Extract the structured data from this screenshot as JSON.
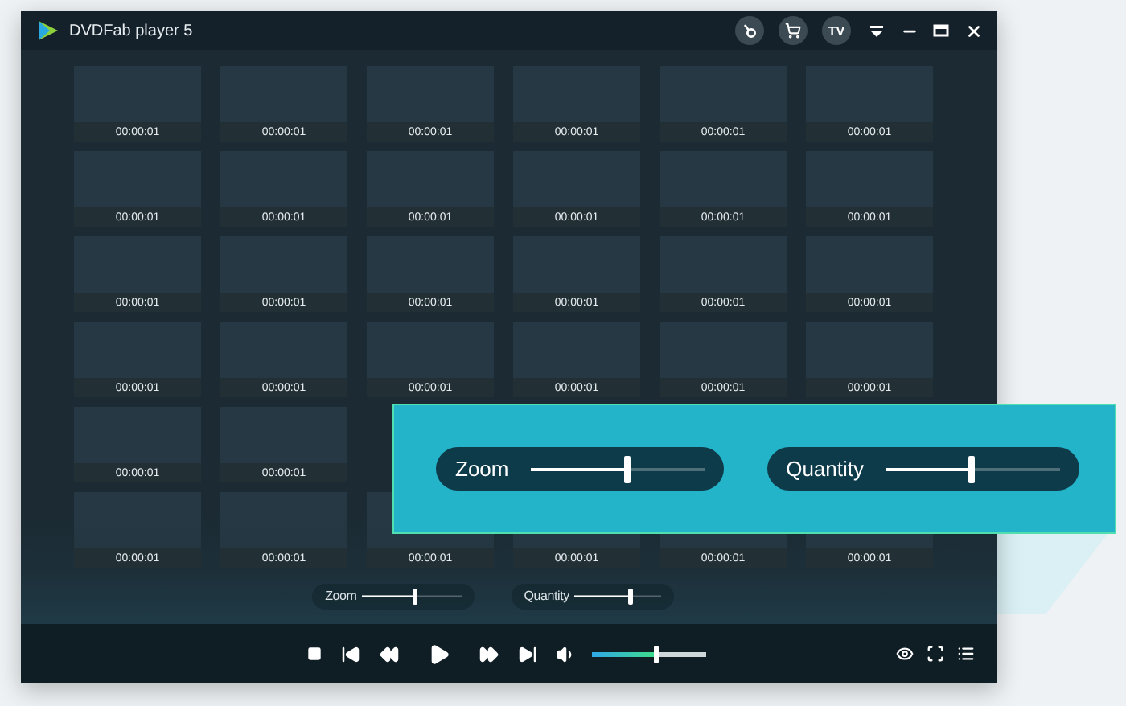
{
  "window": {
    "title": "DVDFab player 5",
    "tv_label": "TV"
  },
  "thumbnail_rows": [
    [
      "00:00:01",
      "00:00:01",
      "00:00:01",
      "00:00:01",
      "00:00:01",
      "00:00:01"
    ],
    [
      "00:00:01",
      "00:00:01",
      "00:00:01",
      "00:00:01",
      "00:00:01",
      "00:00:01"
    ],
    [
      "00:00:01",
      "00:00:01",
      "00:00:01",
      "00:00:01",
      "00:00:01",
      "00:00:01"
    ],
    [
      "00:00:01",
      "00:00:01",
      "00:00:01",
      "00:00:01",
      "00:00:01",
      "00:00:01"
    ],
    [
      "00:00:01",
      "00:00:01"
    ],
    [
      "00:00:01",
      "00:00:01",
      "00:00:01",
      "00:00:01",
      "00:00:01",
      "00:00:01"
    ]
  ],
  "mini_controls": [
    {
      "label": "Zoom",
      "level": 0.53
    },
    {
      "label": "Quantity",
      "level": 0.65
    }
  ],
  "playback": {
    "volume": {
      "level": 0.56
    }
  },
  "callout": {
    "controls": [
      {
        "label": "Zoom",
        "level": 0.55
      },
      {
        "label": "Quantity",
        "level": 0.49
      }
    ]
  }
}
